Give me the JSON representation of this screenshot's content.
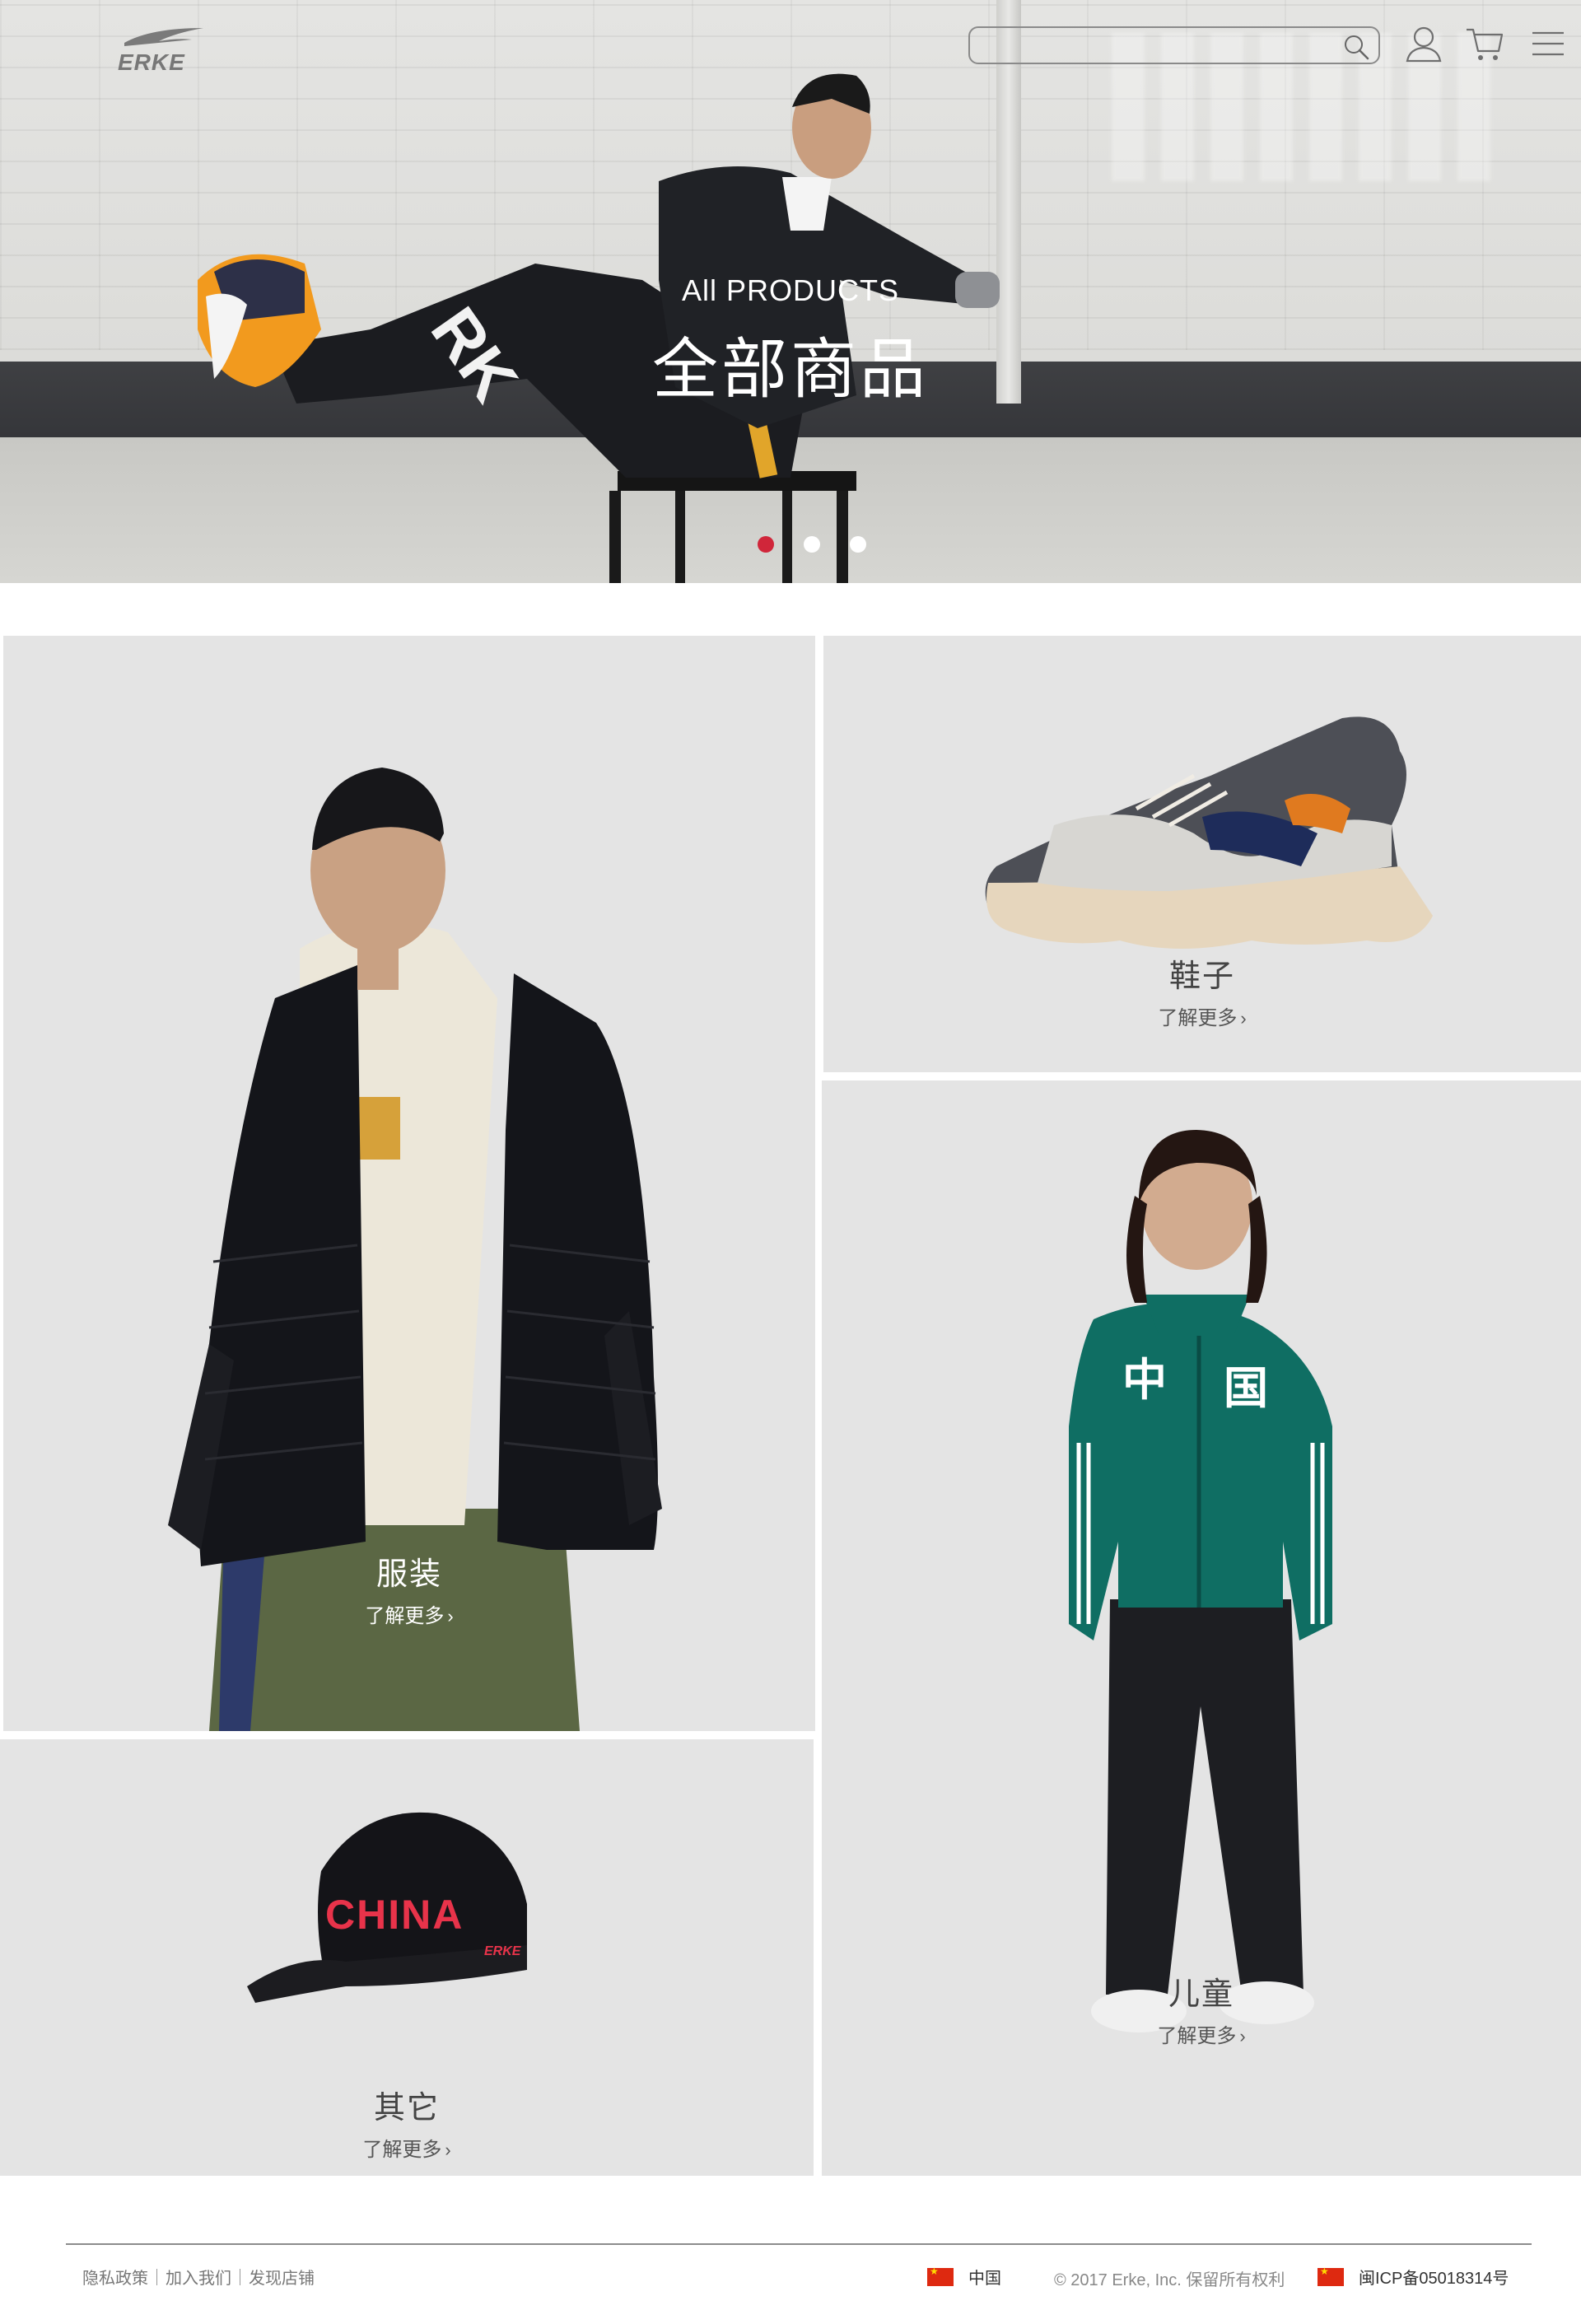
{
  "header": {
    "logo_text": "ERKE",
    "search_placeholder": "",
    "search_value": ""
  },
  "hero": {
    "subtitle": "All PRODUCTS",
    "title": "全部商品",
    "slides": 3,
    "active_slide": 1,
    "accent_color": "#d0263a"
  },
  "tiles": {
    "clothing": {
      "label": "服装",
      "more": "了解更多"
    },
    "shoes": {
      "label": "鞋子",
      "more": "了解更多"
    },
    "kids": {
      "label": "儿童",
      "more": "了解更多"
    },
    "other": {
      "label": "其它",
      "more": "了解更多"
    }
  },
  "footer": {
    "links": [
      "隐私政策",
      "加入我们",
      "发现店铺"
    ],
    "region": "中国",
    "copyright": "© 2017 Erke, Inc. 保留所有权利",
    "icp": "闽ICP备05018314号"
  }
}
